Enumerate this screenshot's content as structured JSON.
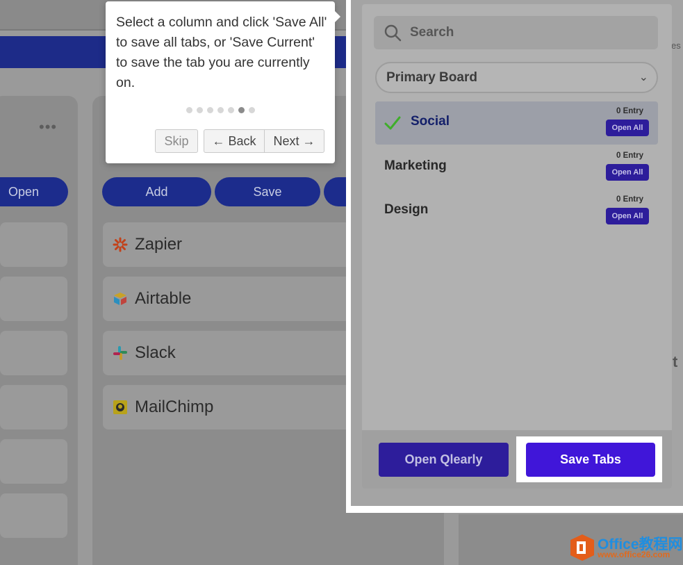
{
  "background": {
    "left_column": {
      "button_label": "Open"
    },
    "main_column": {
      "buttons": [
        {
          "label": "Add"
        },
        {
          "label": "Save"
        }
      ],
      "cards": [
        {
          "label": "Zapier",
          "icon": "zapier-icon"
        },
        {
          "label": "Airtable",
          "icon": "airtable-icon"
        },
        {
          "label": "Slack",
          "icon": "slack-icon"
        },
        {
          "label": "MailChimp",
          "icon": "mailchimp-icon"
        }
      ]
    }
  },
  "tour": {
    "text": "Select a column and click 'Save All' to save all tabs, or 'Save Current' to save the tab you are currently on.",
    "step_total": 7,
    "step_current": 6,
    "skip_label": "Skip",
    "back_label": "← Back",
    "next_label": "Next →"
  },
  "popup": {
    "search_placeholder": "Search",
    "board_select": "Primary Board",
    "columns": [
      {
        "name": "Social",
        "entries": "0 Entry",
        "open_all": "Open All",
        "selected": true
      },
      {
        "name": "Marketing",
        "entries": "0 Entry",
        "open_all": "Open All",
        "selected": false
      },
      {
        "name": "Design",
        "entries": "0 Entry",
        "open_all": "Open All",
        "selected": false
      }
    ],
    "open_qlearly_label": "Open Qlearly",
    "save_tabs_label": "Save Tabs"
  },
  "watermark": {
    "title": "Office教程网",
    "url": "www.office26.com"
  },
  "colors": {
    "accent_purple": "#4016d9",
    "navy": "#1c2c8c",
    "check_green": "#3fae2a"
  }
}
